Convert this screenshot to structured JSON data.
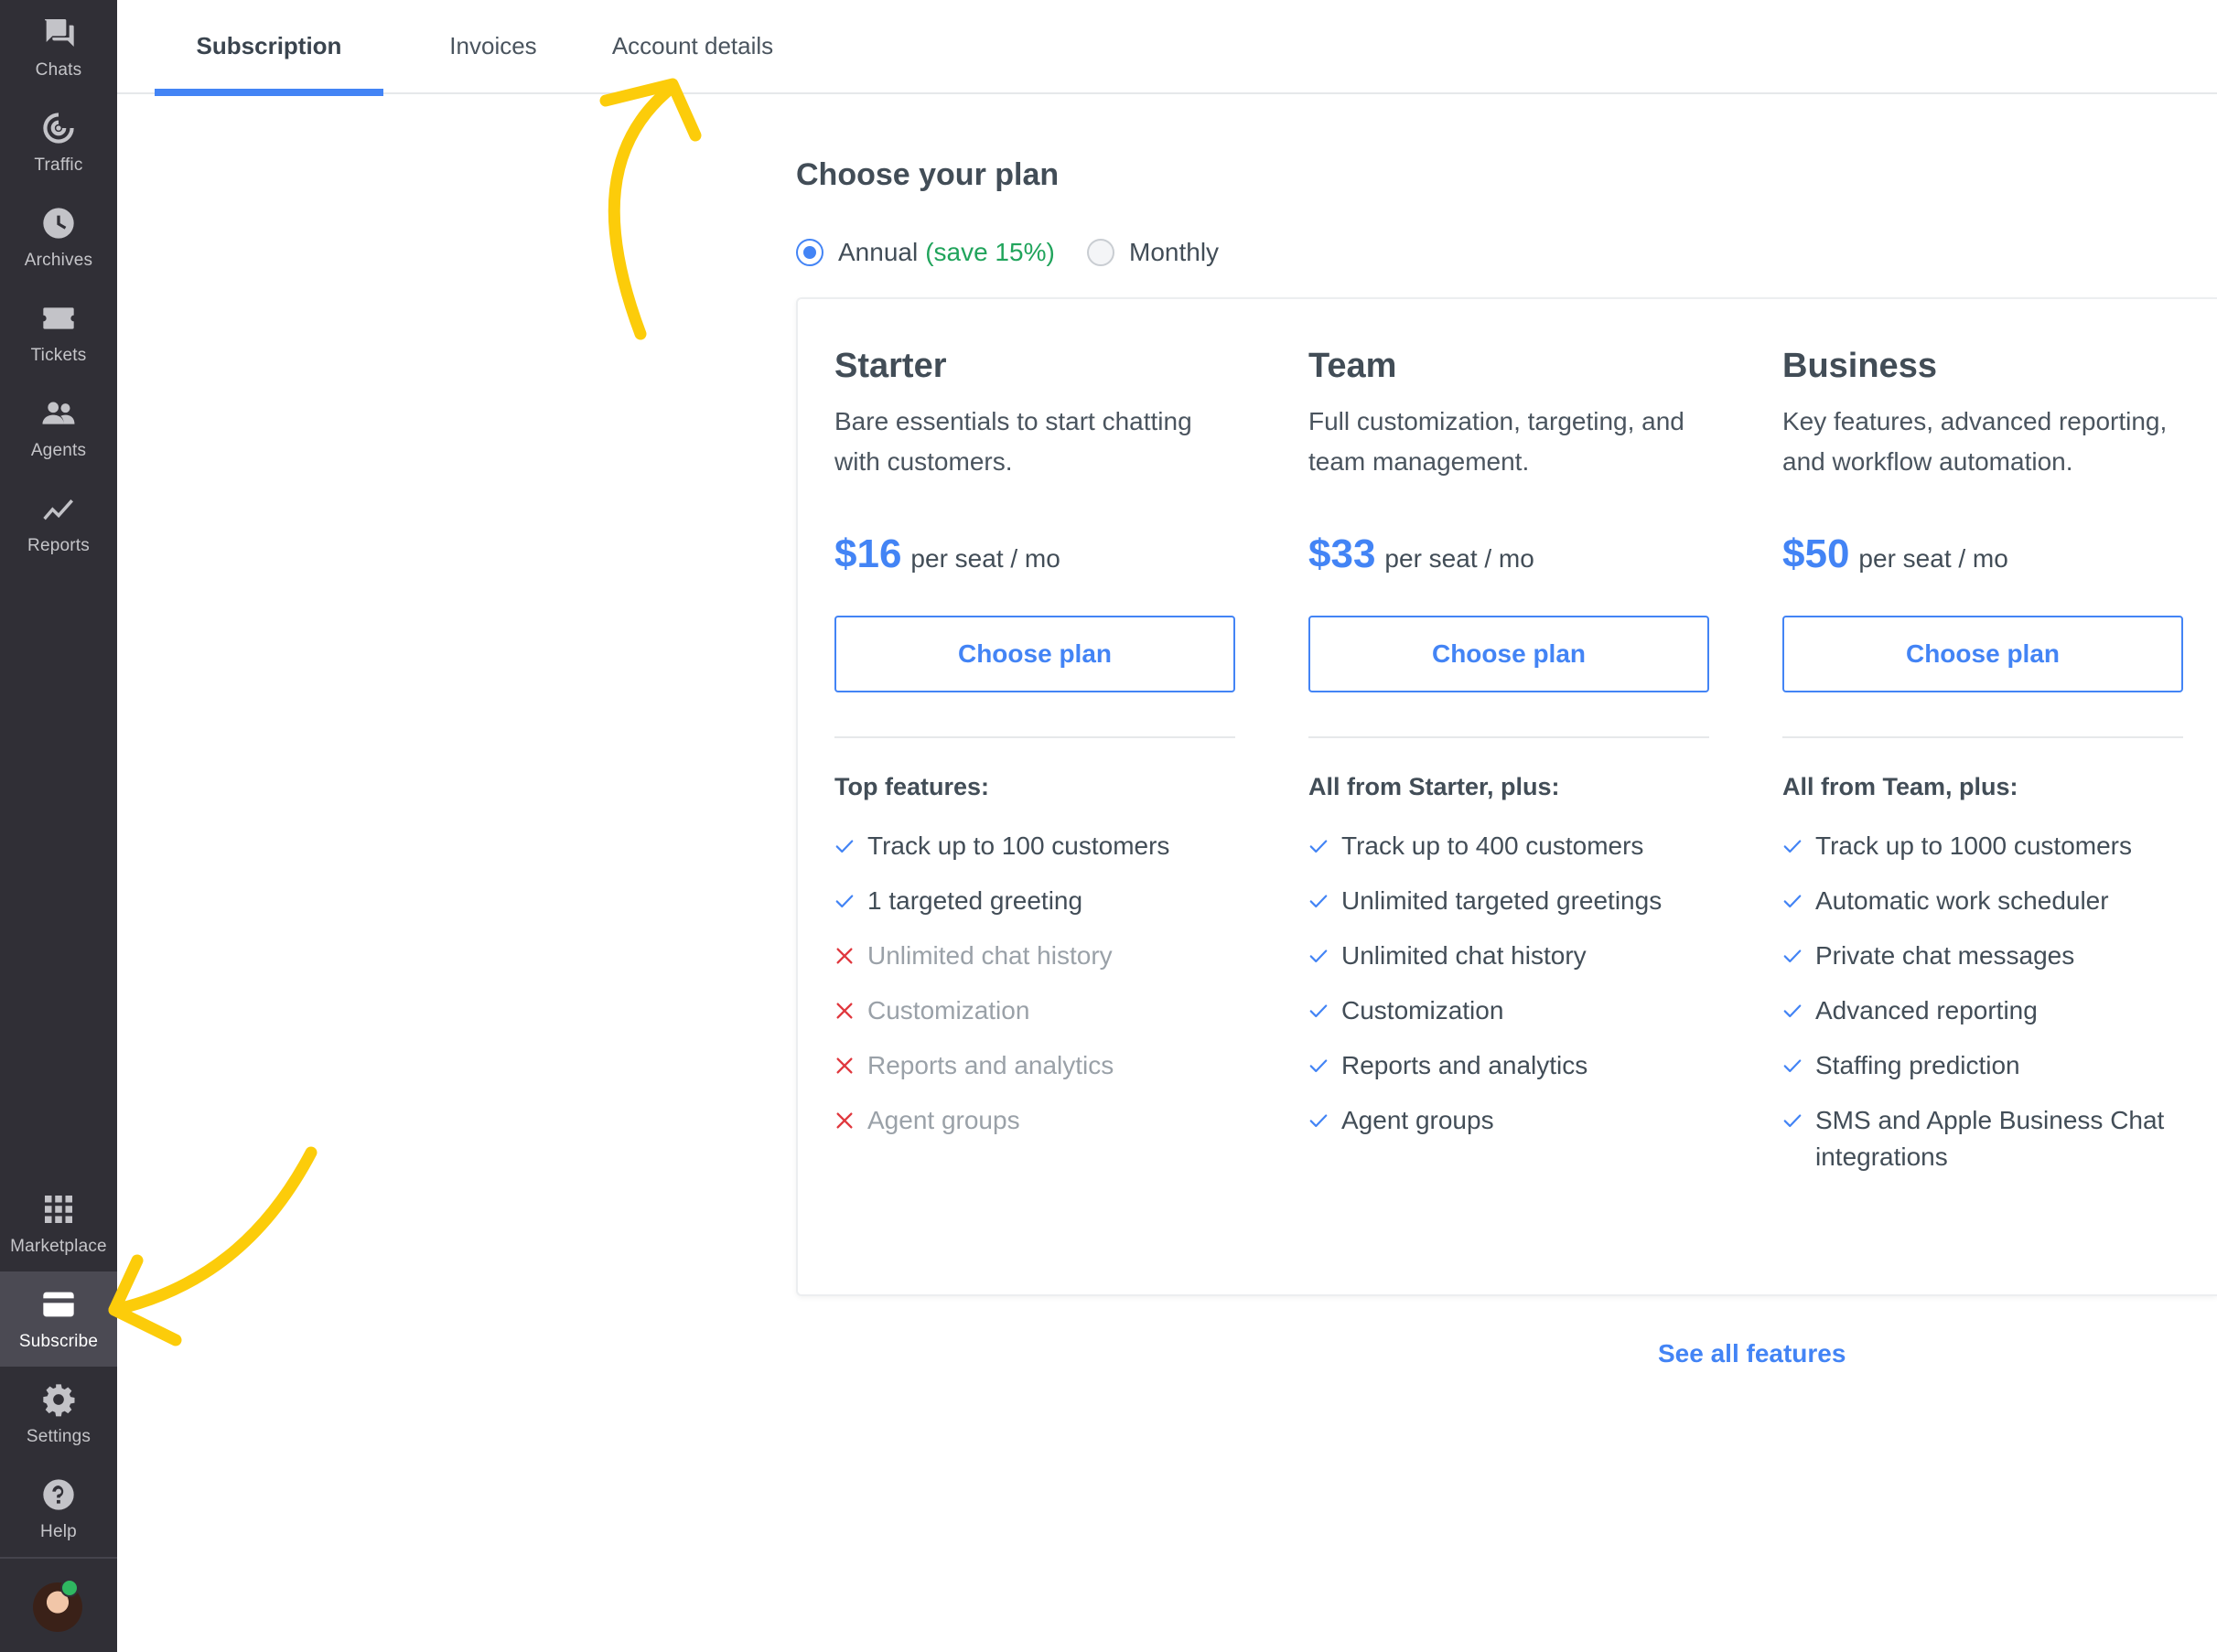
{
  "sidebar": {
    "items": [
      {
        "label": "Chats",
        "icon": "chat-icon"
      },
      {
        "label": "Traffic",
        "icon": "traffic-icon"
      },
      {
        "label": "Archives",
        "icon": "clock-icon"
      },
      {
        "label": "Tickets",
        "icon": "ticket-icon"
      },
      {
        "label": "Agents",
        "icon": "agents-icon"
      },
      {
        "label": "Reports",
        "icon": "reports-icon"
      }
    ],
    "bottom_items": [
      {
        "label": "Marketplace",
        "icon": "grid-icon"
      },
      {
        "label": "Subscribe",
        "icon": "card-icon",
        "active": true
      },
      {
        "label": "Settings",
        "icon": "gear-icon"
      },
      {
        "label": "Help",
        "icon": "help-icon"
      }
    ]
  },
  "tabs": [
    {
      "label": "Subscription",
      "active": true
    },
    {
      "label": "Invoices"
    },
    {
      "label": "Account details"
    }
  ],
  "main": {
    "title": "Choose your plan",
    "billing": {
      "annual_label": "Annual",
      "annual_note": "(save 15%)",
      "monthly_label": "Monthly",
      "selected": "Annual"
    },
    "plans": [
      {
        "name": "Starter",
        "description": "Bare essentials to start chatting with customers.",
        "price": "$16",
        "unit": "per seat / mo",
        "cta": "Choose plan",
        "features_heading": "Top features:",
        "features": [
          {
            "text": "Track up to 100 customers",
            "included": true
          },
          {
            "text": "1 targeted greeting",
            "included": true
          },
          {
            "text": "Unlimited chat history",
            "included": false
          },
          {
            "text": "Customization",
            "included": false
          },
          {
            "text": "Reports and analytics",
            "included": false
          },
          {
            "text": "Agent groups",
            "included": false
          }
        ]
      },
      {
        "name": "Team",
        "description": "Full customization, targeting, and team management.",
        "price": "$33",
        "unit": "per seat / mo",
        "cta": "Choose plan",
        "features_heading": "All from Starter, plus:",
        "features": [
          {
            "text": "Track up to 400 customers",
            "included": true
          },
          {
            "text": "Unlimited targeted greetings",
            "included": true
          },
          {
            "text": "Unlimited chat history",
            "included": true
          },
          {
            "text": "Customization",
            "included": true
          },
          {
            "text": "Reports and analytics",
            "included": true
          },
          {
            "text": "Agent groups",
            "included": true
          }
        ]
      },
      {
        "name": "Business",
        "description": "Key features, advanced reporting, and workflow automation.",
        "price": "$50",
        "unit": "per seat / mo",
        "cta": "Choose plan",
        "features_heading": "All from Team, plus:",
        "features": [
          {
            "text": "Track up to 1000 customers",
            "included": true
          },
          {
            "text": "Automatic work scheduler",
            "included": true
          },
          {
            "text": "Private chat messages",
            "included": true
          },
          {
            "text": "Advanced reporting",
            "included": true
          },
          {
            "text": "Staffing prediction",
            "included": true
          },
          {
            "text": "SMS and Apple Business Chat integrations",
            "included": true
          }
        ]
      }
    ],
    "see_all": "See all features"
  },
  "colors": {
    "sidebar_bg": "#302f36",
    "accent": "#4384f5",
    "success": "#21a45c",
    "excluded": "#e0383e",
    "annotation": "#fccc0a"
  }
}
